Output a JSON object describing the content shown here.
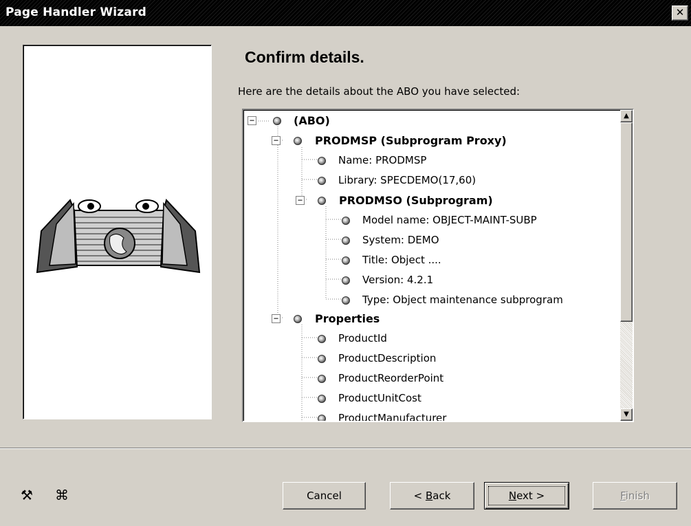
{
  "window": {
    "title": "Page Handler Wizard",
    "close_glyph": "✕"
  },
  "heading": "Confirm details.",
  "intro": "Here are the details about the ABO you have selected:",
  "tree": [
    {
      "label": "(ABO)",
      "bold": true,
      "expander": "−",
      "icon": "node-bullet-icon"
    },
    {
      "label": "PRODMSP (Subprogram Proxy)",
      "bold": true,
      "expander": "−",
      "icon": "node-bullet-icon"
    },
    {
      "label": "Name: PRODMSP",
      "bold": false,
      "icon": "node-bullet-icon"
    },
    {
      "label": "Library: SPECDEMO(17,60)",
      "bold": false,
      "icon": "node-bullet-icon"
    },
    {
      "label": "PRODMSO (Subprogram)",
      "bold": true,
      "expander": "−",
      "icon": "node-bullet-icon"
    },
    {
      "label": "Model name: OBJECT-MAINT-SUBP",
      "bold": false,
      "icon": "node-bullet-icon"
    },
    {
      "label": "System: DEMO",
      "bold": false,
      "icon": "node-bullet-icon"
    },
    {
      "label": "Title: Object ....",
      "bold": false,
      "icon": "node-bullet-icon"
    },
    {
      "label": "Version: 4.2.1",
      "bold": false,
      "icon": "node-bullet-icon"
    },
    {
      "label": "Type: Object maintenance subprogram",
      "bold": false,
      "icon": "node-bullet-icon"
    },
    {
      "label": "Properties",
      "bold": true,
      "expander": "−",
      "icon": "node-bullet-icon"
    },
    {
      "label": "ProductId",
      "bold": false,
      "icon": "node-bullet-icon"
    },
    {
      "label": "ProductDescription",
      "bold": false,
      "icon": "node-bullet-icon"
    },
    {
      "label": "ProductReorderPoint",
      "bold": false,
      "icon": "node-bullet-icon"
    },
    {
      "label": "ProductUnitCost",
      "bold": false,
      "icon": "node-bullet-icon"
    },
    {
      "label": "ProductManufacturer",
      "bold": false,
      "icon": "node-bullet-icon"
    }
  ],
  "scrollbar": {
    "up_glyph": "▲",
    "down_glyph": "▼"
  },
  "footer_icons": {
    "tools_glyph": "⚒",
    "help_glyph": "⌘"
  },
  "buttons": {
    "cancel": "Cancel",
    "back_prefix": "< ",
    "back_key": "B",
    "back_rest": "ack",
    "next_key": "N",
    "next_rest": "ext >",
    "finish_key": "F",
    "finish_rest": "inish"
  },
  "colors": {
    "face": "#d4d0c8",
    "shadow": "#808080",
    "highlight": "#ffffff",
    "disabled_text": "#808080"
  }
}
